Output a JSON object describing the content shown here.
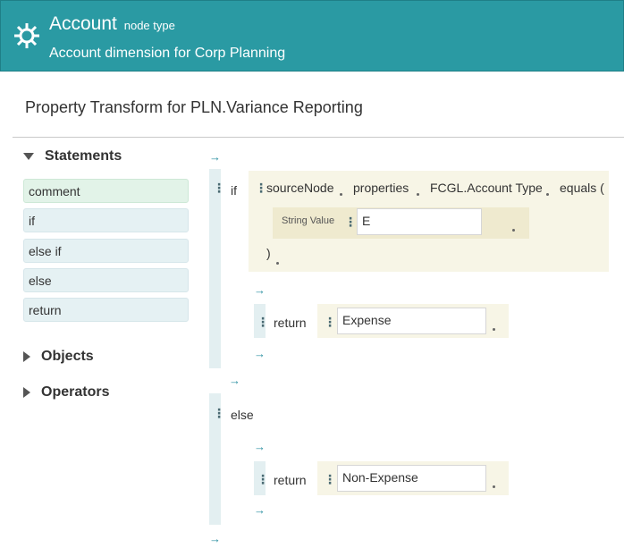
{
  "header": {
    "title": "Account",
    "subtitle": "node type",
    "description": "Account dimension for Corp Planning",
    "icon": "gear-icon",
    "color": "#2a9aa3"
  },
  "page_title": "Property Transform for PLN.Variance Reporting",
  "palette": {
    "statements_label": "Statements",
    "statements": [
      "comment",
      "if",
      "else if",
      "else",
      "return"
    ],
    "objects_label": "Objects",
    "operators_label": "Operators"
  },
  "editor": {
    "arrow": "→",
    "if_keyword": "if",
    "condition": {
      "source": "sourceNode",
      "prop": "properties",
      "field": "FCGL.Account Type",
      "method": "equals (",
      "arg_label": "String Value",
      "arg_value": "E",
      "close": ")"
    },
    "if_return_keyword": "return",
    "if_return_value": "Expense",
    "else_keyword": "else",
    "else_return_keyword": "return",
    "else_return_value": "Non-Expense"
  }
}
